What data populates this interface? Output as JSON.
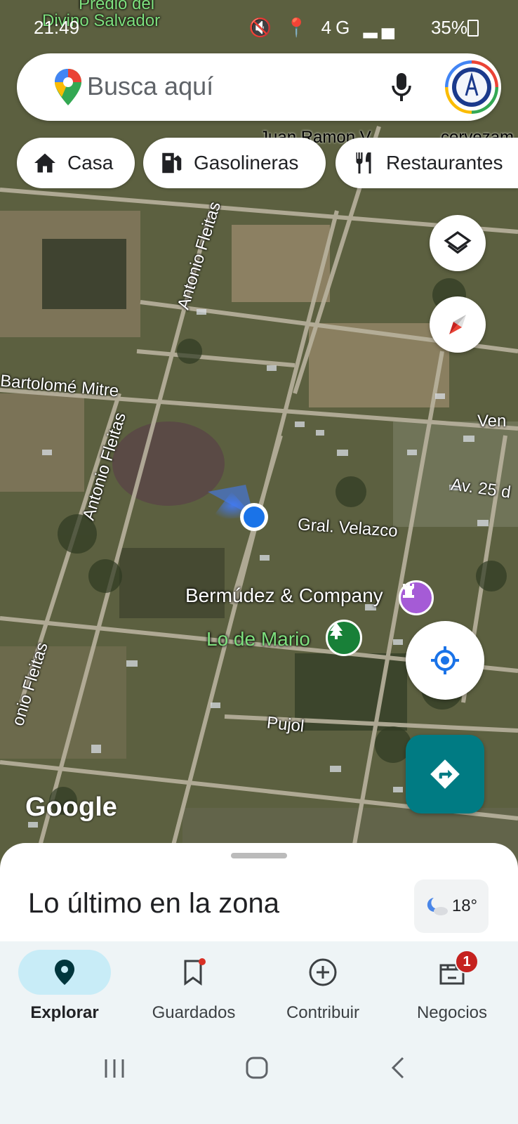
{
  "status_bar": {
    "time": "21:49",
    "battery": "35%",
    "network": "4G"
  },
  "search": {
    "placeholder": "Busca aquí"
  },
  "chips": [
    {
      "label": "Casa",
      "icon": "home-icon"
    },
    {
      "label": "Gasolineras",
      "icon": "gas-station-icon"
    },
    {
      "label": "Restaurantes",
      "icon": "restaurant-icon"
    }
  ],
  "map_labels": {
    "street_top": "Juan Ramon V",
    "street_top_right": "cervezam",
    "predio": "Predio del",
    "predio2": "Divino Salvador",
    "antonio_fleitas_1": "Antonio Fleitas",
    "antonio_fleitas_2": "Antonio Fleitas",
    "antonio_fleitas_3": "onio Fleitas",
    "bartolome": "Bartolomé Mitre",
    "ven": "Ven",
    "av25": "Av. 25 d",
    "velazco": "Gral. Velazco",
    "pujol": "Pujol"
  },
  "pois": [
    {
      "label": "Bermúdez & Company",
      "color": "#ffffff",
      "icon": "chess-rook-icon"
    },
    {
      "label": "Lo de Mario",
      "color": "#7ee07e",
      "icon": "tree-icon"
    }
  ],
  "attribution": "Google",
  "bottom_sheet": {
    "title": "Lo último en la zona",
    "temperature": "18°"
  },
  "bottom_nav": [
    {
      "label": "Explorar",
      "icon": "explore-pin-icon",
      "active": true
    },
    {
      "label": "Guardados",
      "icon": "bookmark-icon",
      "active": false
    },
    {
      "label": "Contribuir",
      "icon": "add-circle-icon",
      "active": false
    },
    {
      "label": "Negocios",
      "icon": "store-icon",
      "active": false,
      "badge": "1"
    }
  ],
  "colors": {
    "accent": "#007b83",
    "nav_active": "#c8ecf7",
    "blue_dot": "#1a73e8"
  }
}
